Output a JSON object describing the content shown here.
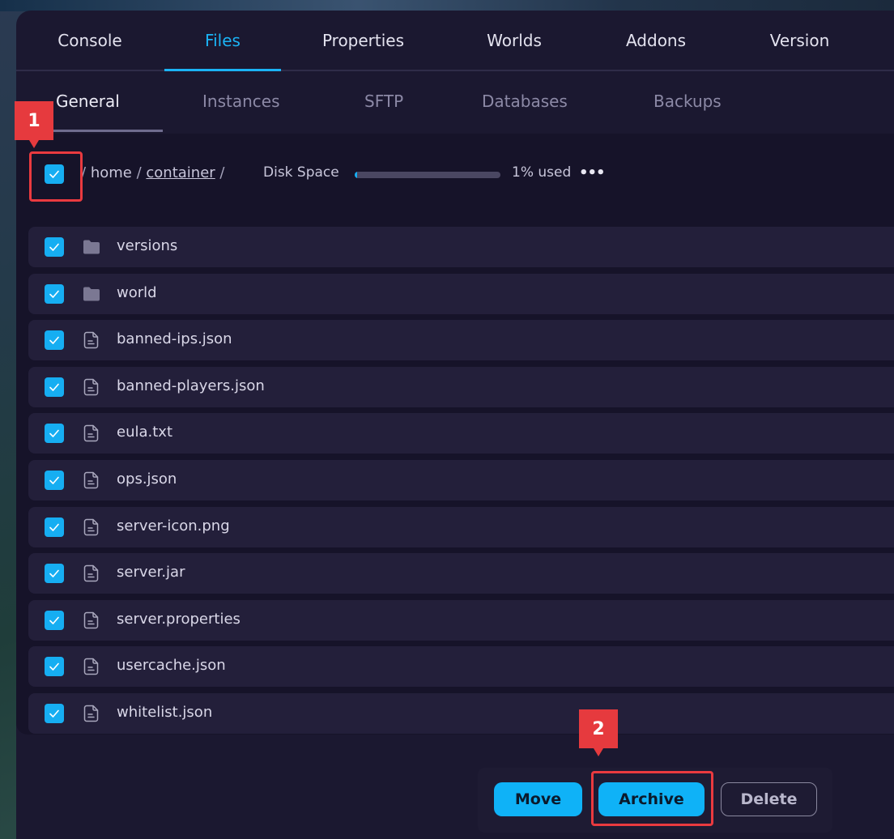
{
  "top_tabs": [
    "Console",
    "Files",
    "Properties",
    "Worlds",
    "Addons",
    "Version"
  ],
  "sub_tabs": [
    "General",
    "Instances",
    "SFTP",
    "Databases",
    "Backups"
  ],
  "path": {
    "root_sep": "/",
    "home": "home",
    "sep1": "/",
    "container": "container",
    "sep2": "/"
  },
  "disk": {
    "label": "Disk Space",
    "used_text": "1% used",
    "used_fraction": 0.01
  },
  "more_icon": "more-horizontal-icon",
  "files": [
    {
      "name": "versions",
      "type": "folder",
      "checked": true
    },
    {
      "name": "world",
      "type": "folder",
      "checked": true
    },
    {
      "name": "banned-ips.json",
      "type": "file",
      "checked": true
    },
    {
      "name": "banned-players.json",
      "type": "file",
      "checked": true
    },
    {
      "name": "eula.txt",
      "type": "file",
      "checked": true
    },
    {
      "name": "ops.json",
      "type": "file",
      "checked": true
    },
    {
      "name": "server-icon.png",
      "type": "file",
      "checked": true
    },
    {
      "name": "server.jar",
      "type": "file",
      "checked": true
    },
    {
      "name": "server.properties",
      "type": "file",
      "checked": true
    },
    {
      "name": "usercache.json",
      "type": "file",
      "checked": true
    },
    {
      "name": "whitelist.json",
      "type": "file",
      "checked": true
    }
  ],
  "actions": {
    "move": "Move",
    "archive": "Archive",
    "delete": "Delete"
  },
  "annotations": {
    "one": "1",
    "two": "2"
  },
  "colors": {
    "accent": "#16aef2",
    "annotation": "#e63a3e",
    "panel": "#1b1830",
    "row": "#231f3a"
  }
}
